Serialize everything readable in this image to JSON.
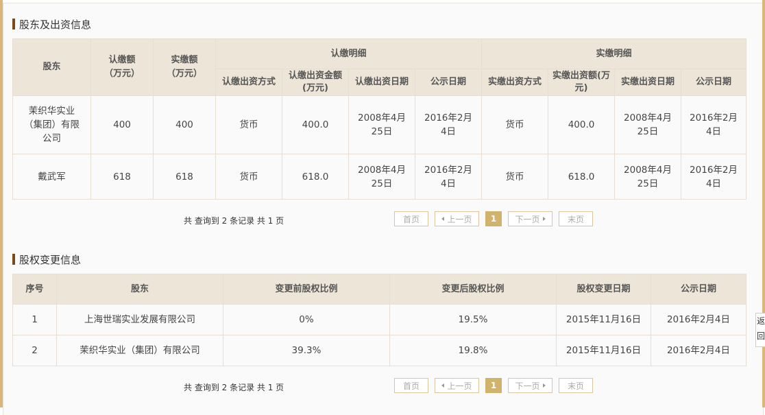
{
  "shareholders": {
    "title": "股东及出资信息",
    "headers": {
      "shareholder": "股东",
      "subscribed_amount": "认缴额\n（万元）",
      "paid_amount": "实缴额\n（万元）",
      "subscribed_detail": "认缴明细",
      "paid_detail": "实缴明细",
      "sub_method": "认缴出资方式",
      "sub_amount": "认缴出资金额\n(万元)",
      "sub_date": "认缴出资日期",
      "sub_pub_date": "公示日期",
      "paid_method": "实缴出资方式",
      "paid_amt": "实缴出资额(万\n元)",
      "paid_date": "实缴出资日期",
      "paid_pub_date": "公示日期"
    },
    "rows": [
      {
        "name": "茉织华实业\n（集团）有限\n公司",
        "subscribed": "400",
        "paid": "400",
        "sub_method": "货币",
        "sub_amount": "400.0",
        "sub_date": "2008年4月\n25日",
        "sub_pub": "2016年2月\n4日",
        "paid_method": "货币",
        "paid_amt": "400.0",
        "paid_date": "2008年4月\n25日",
        "paid_pub": "2016年2月\n4日"
      },
      {
        "name": "戴武军",
        "subscribed": "618",
        "paid": "618",
        "sub_method": "货币",
        "sub_amount": "618.0",
        "sub_date": "2008年4月\n25日",
        "sub_pub": "2016年2月\n4日",
        "paid_method": "货币",
        "paid_amt": "618.0",
        "paid_date": "2008年4月\n25日",
        "paid_pub": "2016年2月\n4日"
      }
    ],
    "summary": "共 查询到 2 条记录 共 1 页",
    "pager": {
      "first": "首页",
      "prev": "上一页",
      "current": "1",
      "next": "下一页",
      "last": "末页"
    }
  },
  "equity_changes": {
    "title": "股权变更信息",
    "headers": {
      "index": "序号",
      "shareholder": "股东",
      "before": "变更前股权比例",
      "after": "变更后股权比例",
      "change_date": "股权变更日期",
      "pub_date": "公示日期"
    },
    "rows": [
      {
        "index": "1",
        "name": "上海世瑞实业发展有限公司",
        "before": "0%",
        "after": "19.5%",
        "change_date": "2015年11月16日",
        "pub_date": "2016年2月4日"
      },
      {
        "index": "2",
        "name": "茉织华实业（集团）有限公司",
        "before": "39.3%",
        "after": "19.8%",
        "change_date": "2015年11月16日",
        "pub_date": "2016年2月4日"
      }
    ],
    "summary": "共 查询到 2 条记录 共 1 页",
    "pager": {
      "first": "首页",
      "prev": "上一页",
      "current": "1",
      "next": "下一页",
      "last": "末页"
    }
  },
  "side_tab": {
    "label": "返回导航"
  }
}
